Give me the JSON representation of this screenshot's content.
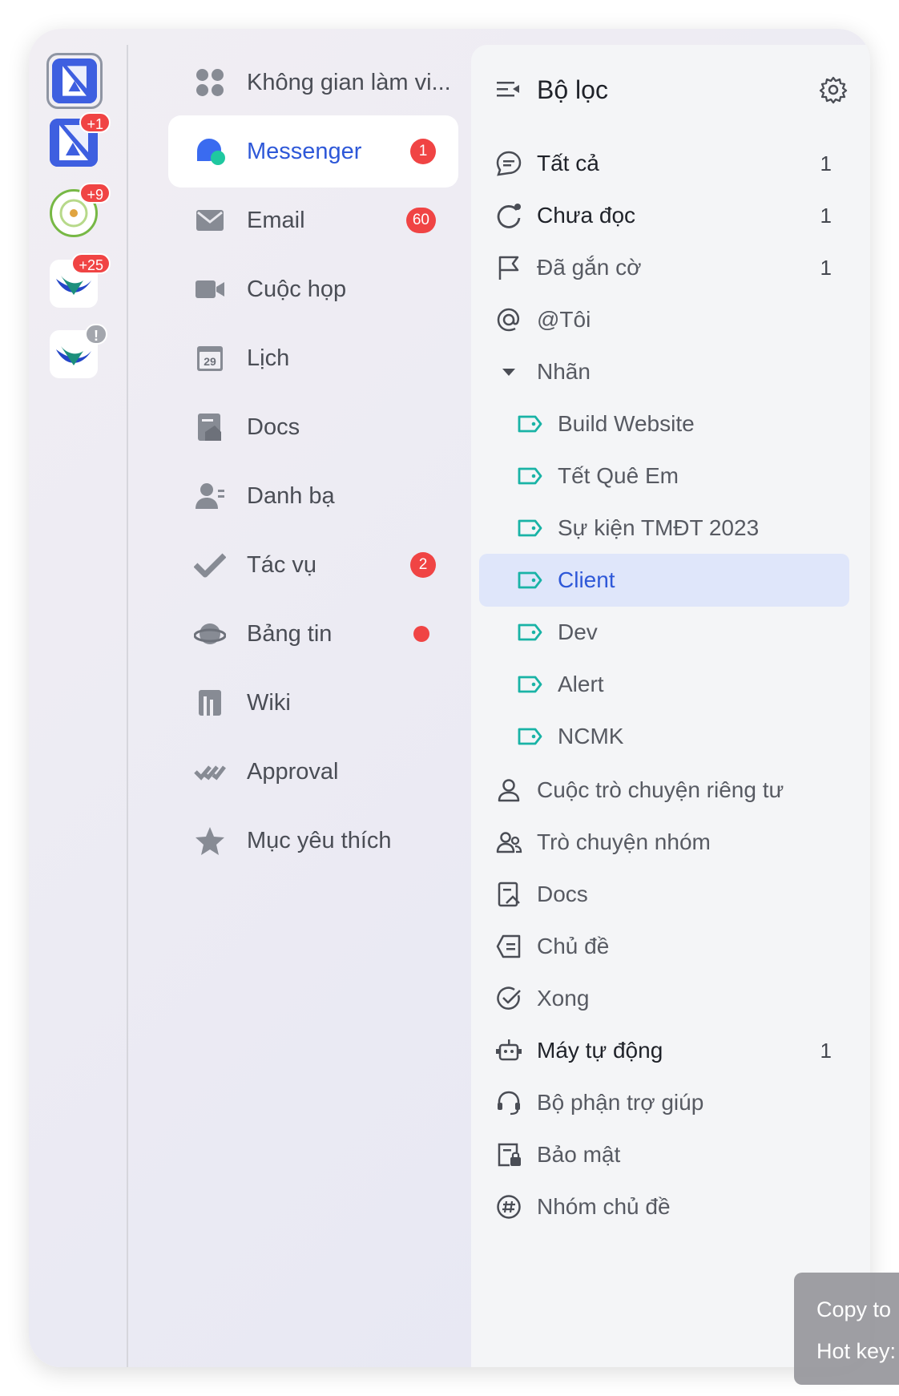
{
  "rail": {
    "apps": [
      {
        "name": "lark-workspace-active",
        "badge": ""
      },
      {
        "name": "lark-workspace-2",
        "badge": "+1"
      },
      {
        "name": "green-org",
        "badge": "+9"
      },
      {
        "name": "blue-bird-1",
        "badge": "+25"
      },
      {
        "name": "blue-bird-2",
        "badge": "!"
      }
    ]
  },
  "nav": {
    "workspace_label": "Không gian làm vi...",
    "items": [
      {
        "label": "Messenger",
        "badge": "1"
      },
      {
        "label": "Email",
        "badge": "60"
      },
      {
        "label": "Cuộc họp",
        "badge": ""
      },
      {
        "label": "Lịch",
        "badge": "",
        "icon_text": "29"
      },
      {
        "label": "Docs",
        "badge": ""
      },
      {
        "label": "Danh bạ",
        "badge": ""
      },
      {
        "label": "Tác vụ",
        "badge": "2"
      },
      {
        "label": "Bảng tin",
        "badge": ""
      },
      {
        "label": "Wiki",
        "badge": ""
      },
      {
        "label": "Approval",
        "badge": ""
      },
      {
        "label": "Mục yêu thích",
        "badge": ""
      }
    ]
  },
  "filter": {
    "title": "Bộ lọc",
    "items": [
      {
        "label": "Tất cả",
        "count": "1"
      },
      {
        "label": "Chưa đọc",
        "count": "1"
      },
      {
        "label": "Đã gắn cờ",
        "count": "1"
      },
      {
        "label": "@Tôi",
        "count": ""
      },
      {
        "label": "Nhãn",
        "count": ""
      },
      {
        "label": "Build Website",
        "count": ""
      },
      {
        "label": "Tết Quê Em",
        "count": ""
      },
      {
        "label": "Sự kiện TMĐT 2023",
        "count": ""
      },
      {
        "label": "Client",
        "count": ""
      },
      {
        "label": "Dev",
        "count": ""
      },
      {
        "label": "Alert",
        "count": ""
      },
      {
        "label": "NCMK",
        "count": ""
      },
      {
        "label": "Cuộc trò chuyện riêng tư",
        "count": ""
      },
      {
        "label": "Trò chuyện nhóm",
        "count": ""
      },
      {
        "label": "Docs",
        "count": ""
      },
      {
        "label": "Chủ đề",
        "count": ""
      },
      {
        "label": "Xong",
        "count": ""
      },
      {
        "label": "Máy tự động",
        "count": "1"
      },
      {
        "label": "Bộ phận trợ giúp",
        "count": ""
      },
      {
        "label": "Bảo mật",
        "count": ""
      },
      {
        "label": "Nhóm chủ đề",
        "count": ""
      }
    ]
  },
  "tooltip": {
    "line1": "Copy to",
    "line2": "Hot key:"
  },
  "colors": {
    "accent": "#2e58d8",
    "badge": "#f04444",
    "tag": "#19b3a6",
    "selected_bg": "#dfe6fa"
  }
}
